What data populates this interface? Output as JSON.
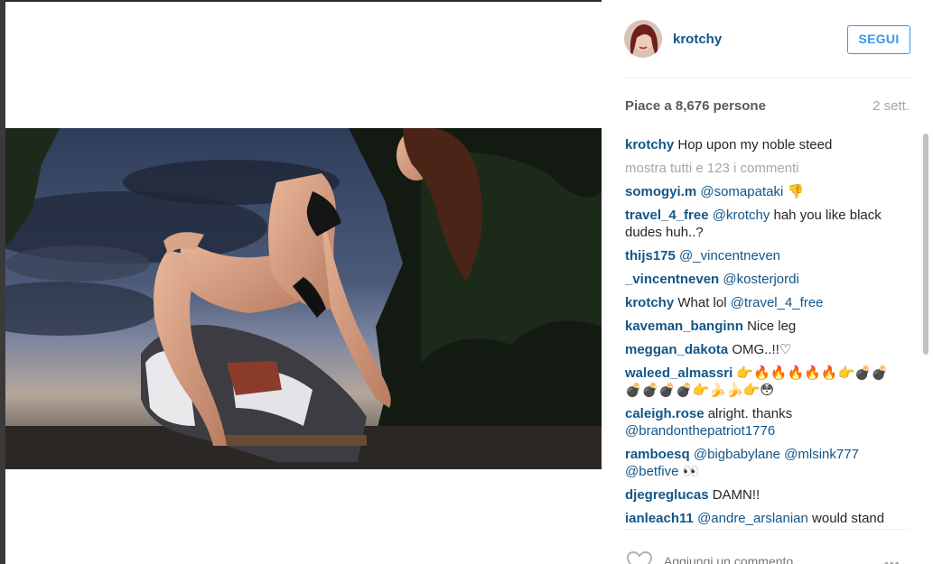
{
  "post": {
    "image_alt": "Photo of a woman in black lingerie sitting on a painted toy horse at dusk",
    "username": "krotchy",
    "follow_label": "SEGUI",
    "likes_text": "Piace a 8,676 persone",
    "time_ago": "2 sett.",
    "load_more": "mostra tutti e 123 i commenti",
    "add_comment_placeholder": "Aggiungi un commento...",
    "more_options": "•••"
  },
  "comments": [
    {
      "user": "krotchy",
      "text": "Hop upon my noble steed"
    },
    {
      "user": "somogyi.m",
      "mention": "@somapataki",
      "text": "",
      "emoji": "👎"
    },
    {
      "user": "travel_4_free",
      "mention": "@krotchy",
      "text": "hah you like black dudes huh..?"
    },
    {
      "user": "thijs175",
      "mention": "@_vincentneven",
      "text": ""
    },
    {
      "user": "_vincentneven",
      "mention": "@kosterjordi",
      "text": ""
    },
    {
      "user": "krotchy",
      "text": "What lol",
      "mention2": "@travel_4_free"
    },
    {
      "user": "kaveman_banginn",
      "text": "Nice leg"
    },
    {
      "user": "meggan_dakota",
      "text": "OMG..!!♡"
    },
    {
      "user": "waleed_almassri",
      "text": "",
      "emoji": "👉🔥🔥🔥🔥🔥👉💣💣💣💣💣💣👉🍌🍌👉😳"
    },
    {
      "user": "caleigh.rose",
      "text": "alright. thanks",
      "mention2": "@brandonthepatriot1776"
    },
    {
      "user": "ramboesq",
      "mention": "@bigbabylane @mlsink777 @betfive",
      "text": "",
      "emoji": "👀"
    },
    {
      "user": "djegreglucas",
      "text": "DAMN!!"
    },
    {
      "user": "ianleach11",
      "mention": "@andre_arslanian",
      "text": "would stand"
    }
  ],
  "colors": {
    "link": "#125688",
    "follow": "#3897f0",
    "muted": "#a5a7aa"
  },
  "icons": {
    "like": "heart-outline-icon"
  }
}
